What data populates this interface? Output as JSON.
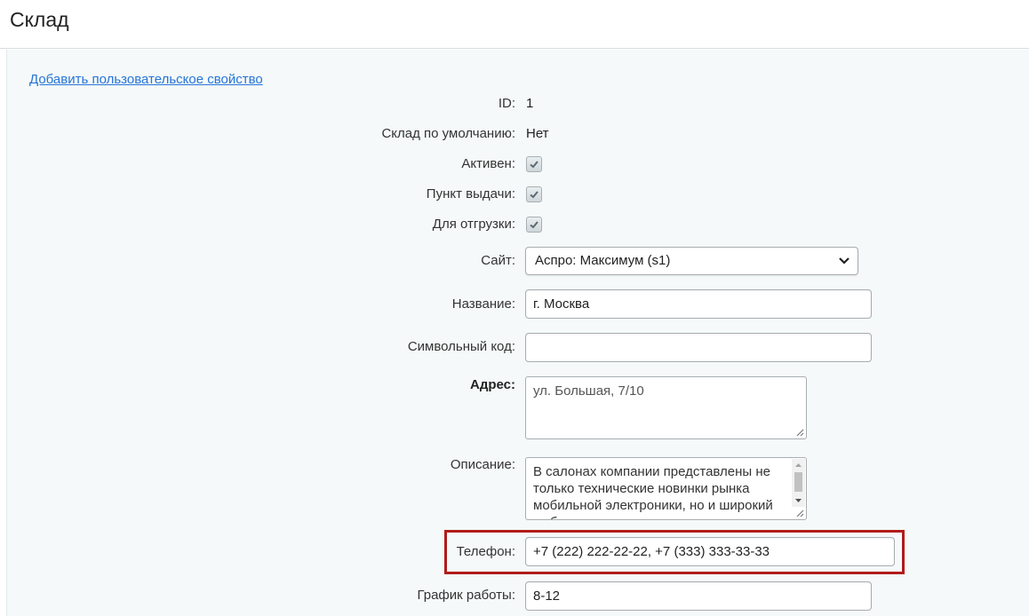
{
  "page": {
    "title": "Склад"
  },
  "links": {
    "add_property": "Добавить пользовательское свойство"
  },
  "fields": {
    "id": {
      "label": "ID:",
      "value": "1"
    },
    "default_store": {
      "label": "Склад по умолчанию:",
      "value": "Нет"
    },
    "active": {
      "label": "Активен:",
      "checked": true
    },
    "pickup": {
      "label": "Пункт выдачи:",
      "checked": true
    },
    "shipping": {
      "label": "Для отгрузки:",
      "checked": true
    },
    "site": {
      "label": "Сайт:",
      "selected": "Аспро: Максимум (s1)"
    },
    "name": {
      "label": "Название:",
      "value": "г. Москва"
    },
    "code": {
      "label": "Символьный код:",
      "value": ""
    },
    "address": {
      "label": "Адрес:",
      "value": "ул. Большая, 7/10"
    },
    "description": {
      "label": "Описание:",
      "value": "В салонах компании представлены не только технические новинки рынка мобильной электроники, но и широкий выбор дополнительных"
    },
    "phone": {
      "label": "Телефон:",
      "value": "+7 (222) 222-22-22, +7 (333) 333-33-33"
    },
    "schedule": {
      "label": "График работы:",
      "value": "8-12"
    }
  },
  "colors": {
    "link": "#2675d7",
    "highlight": "#b11b1b",
    "panel_bg": "#f5f9f9"
  }
}
